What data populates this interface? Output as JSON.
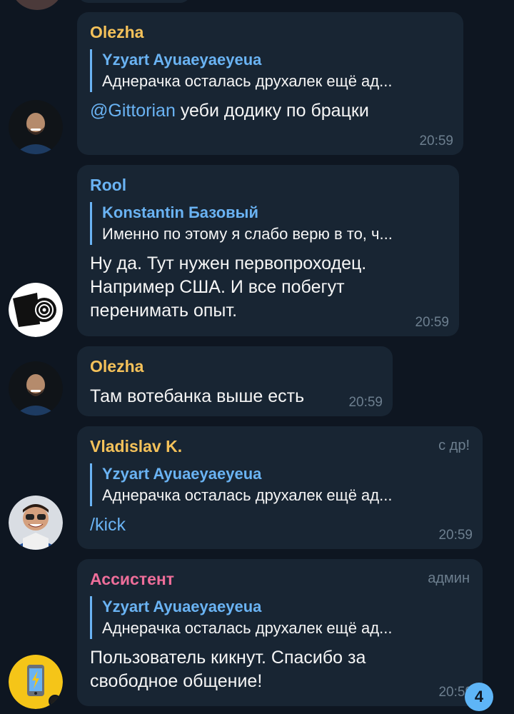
{
  "messages": [
    {
      "sender": "Olezha",
      "sender_color": "#f5c25a",
      "reply": {
        "name": "Yzyart Ayuaeyaeyeua",
        "text": "Аднерачка осталась друхалек ещё ад..."
      },
      "mention": "@Gittorian",
      "text": " уеби додику по брацки",
      "time": "20:59"
    },
    {
      "sender": "Rool",
      "sender_color": "#6ab3f3",
      "reply": {
        "name": "Konstantin Базовый",
        "text": "Именно по этому я слабо верю в то, ч..."
      },
      "text": "Ну да. Тут нужен первопроходец. Например США. И все побегут перенимать опыт.",
      "time": "20:59"
    },
    {
      "sender": "Olezha",
      "sender_color": "#f5c25a",
      "text": "Там вотебанка выше есть",
      "time": "20:59"
    },
    {
      "sender": "Vladislav K.",
      "sender_color": "#f5c25a",
      "tag": "с др!",
      "reply": {
        "name": "Yzyart Ayuaeyaeyeua",
        "text": "Аднерачка осталась друхалек ещё ад..."
      },
      "text": "/kick",
      "time": "20:59"
    },
    {
      "sender": "Ассистент",
      "sender_color": "#ee6e9a",
      "tag": "админ",
      "reply": {
        "name": "Yzyart Ayuaeyaeyeua",
        "text": "Аднерачка осталась друхалек ещё ад..."
      },
      "text": "Пользователь кикнут. Спасибо за свободное общение!",
      "time": "20:59"
    }
  ],
  "unread_count": "4"
}
